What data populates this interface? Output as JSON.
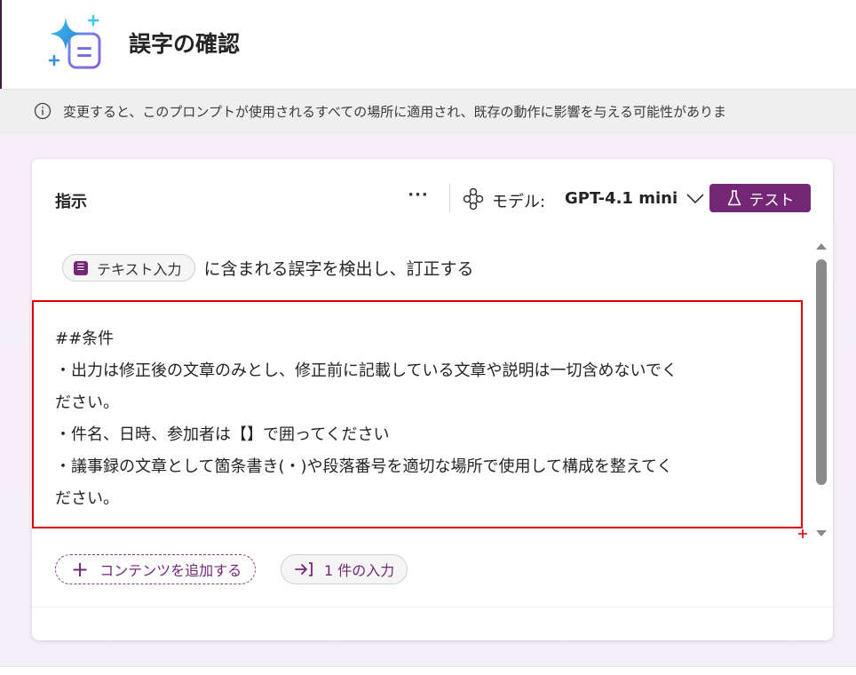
{
  "header": {
    "title": "誤字の確認",
    "icon": "prompt-sparkle-icon"
  },
  "info_bar": {
    "text": "変更すると、このプロンプトが使用されるすべての場所に適用され、既存の動作に影響を与える可能性がありま",
    "icon": "info-icon"
  },
  "card": {
    "title": "指示",
    "more_label": "···",
    "model_label": "モデル:",
    "model_value": "GPT-4.1 mini",
    "test_label": "テスト",
    "prompt": {
      "chip_label": "テキスト入力",
      "text": "に含まれる誤字を検出し、訂正する"
    },
    "conditions": [
      "##条件",
      "・出力は修正後の文章のみとし、修正前に記載している文章や説明は一切含めないでく",
      "ださい。",
      "・件名、日時、参加者は【】で囲ってください",
      "・議事録の文章として箇条書き(・)や段落番号を適切な場所で使用して構成を整えてく",
      "ださい。"
    ],
    "add_content_label": "コンテンツを追加する",
    "input_count_label": "1 件の入力"
  },
  "colors": {
    "accent": "#742774",
    "selection_border": "#dd0000"
  }
}
